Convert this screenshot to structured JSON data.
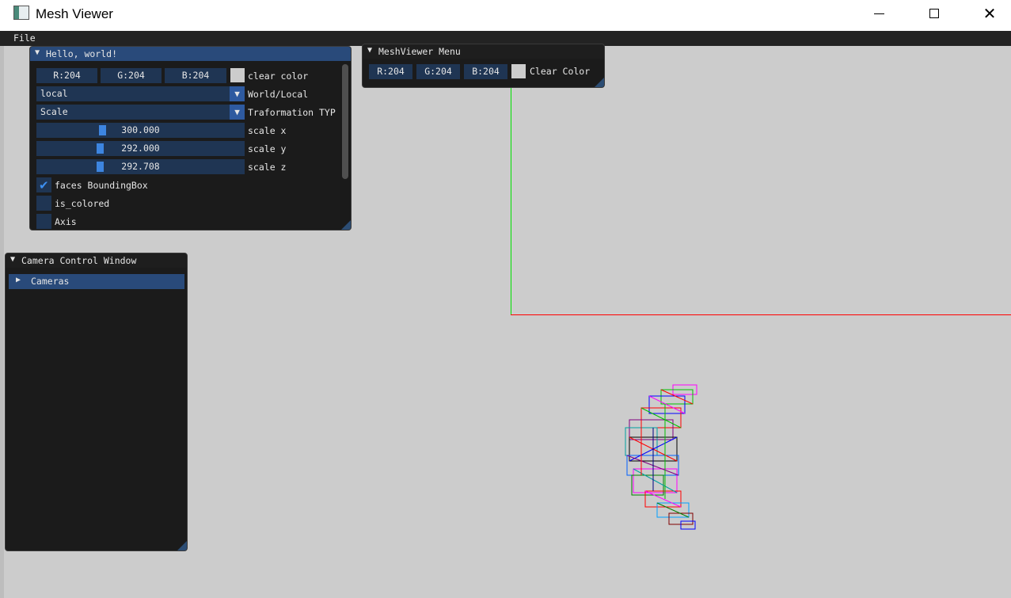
{
  "window": {
    "title": "Mesh Viewer",
    "controls": {
      "minimize": "—",
      "maximize": "□",
      "close": "✕"
    }
  },
  "menubar": {
    "items": [
      "File"
    ]
  },
  "hello_window": {
    "title": "Hello, world!",
    "collapse_glyph": "▼",
    "clear_color": {
      "r": "R:204",
      "g": "G:204",
      "b": "B:204",
      "label": "clear color",
      "swatch_color": "#cccccc"
    },
    "space_combo": {
      "value": "local",
      "label": "World/Local",
      "arrow": "▼"
    },
    "transform_combo": {
      "value": "Scale",
      "label": "Traformation TYP",
      "arrow": "▼"
    },
    "sliders": [
      {
        "value": "300.000",
        "label": "scale x",
        "fraction": 0.31
      },
      {
        "value": "292.000",
        "label": "scale y",
        "fraction": 0.3
      },
      {
        "value": "292.708",
        "label": "scale z",
        "fraction": 0.3
      }
    ],
    "checkboxes": [
      {
        "label": "faces BoundingBox",
        "checked": true,
        "mark": "✔"
      },
      {
        "label": "is_colored",
        "checked": false
      },
      {
        "label": "Axis",
        "checked": false
      }
    ]
  },
  "meshviewer_menu": {
    "title": "MeshViewer Menu",
    "collapse_glyph": "▼",
    "clear_color": {
      "r": "R:204",
      "g": "G:204",
      "b": "B:204",
      "label": "Clear Color",
      "swatch_color": "#cccccc"
    }
  },
  "camera_window": {
    "title": "Camera Control Window",
    "collapse_glyph": "▼",
    "tree": {
      "label": "Cameras",
      "expand_glyph": "▶"
    }
  },
  "viewport": {
    "background": "#cccccc",
    "axis_colors": {
      "y": "#00e000",
      "x": "#ff0000"
    },
    "mesh_icon": "wireframe-mesh"
  }
}
